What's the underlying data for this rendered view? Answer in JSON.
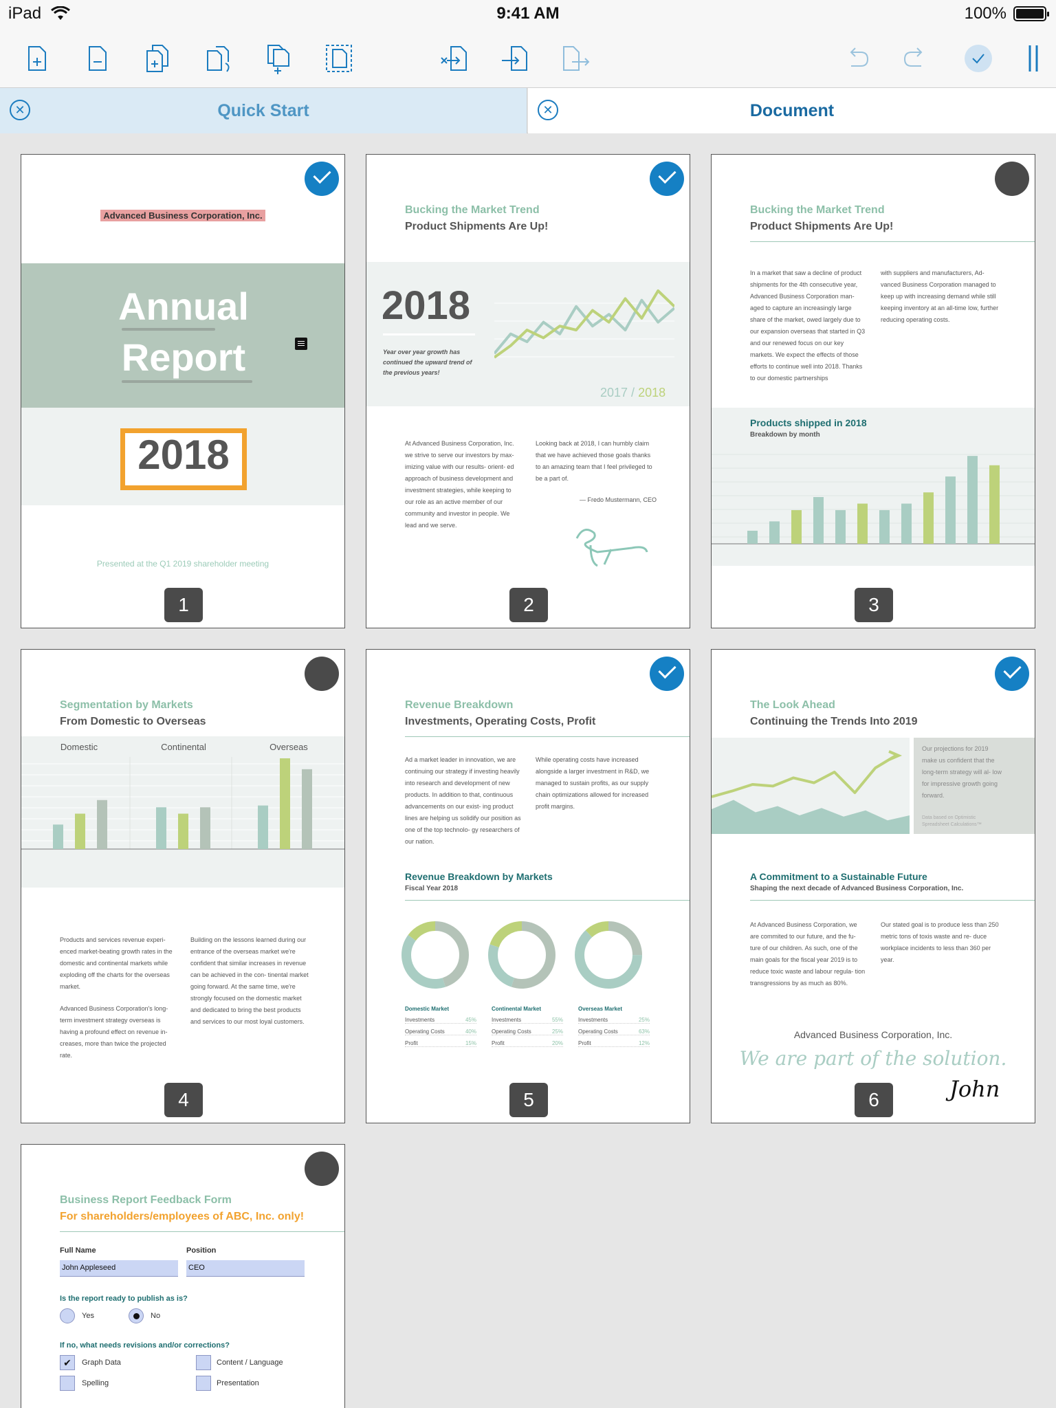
{
  "status": {
    "device": "iPad",
    "time": "9:41 AM",
    "battery": "100%"
  },
  "toolbar": {
    "left_icons": [
      "add-page-icon",
      "remove-page-icon",
      "duplicate-page-icon",
      "rotate-page-icon",
      "insert-pages-icon",
      "select-area-icon"
    ],
    "middle_icons": [
      "extract-page-icon",
      "import-page-icon",
      "export-page-icon"
    ],
    "right_icons": [
      "undo-icon",
      "redo-icon",
      "done-icon",
      "split-view-icon"
    ]
  },
  "tabs": [
    {
      "label": "Quick Start"
    },
    {
      "label": "Document"
    }
  ],
  "pages": [
    {
      "number": "1",
      "selected": true,
      "company": "Advanced Business Corporation, Inc.",
      "title1": "Annual",
      "title2": "Report",
      "year": "2018",
      "footer": "Presented at the Q1 2019 shareholder meeting"
    },
    {
      "number": "2",
      "selected": true,
      "heading": "Bucking the Market Trend",
      "subheading": "Product Shipments Are Up!",
      "year": "2018",
      "caption": "Year over year growth has continued the upward trend of the previous years!",
      "years_a": "2017",
      "years_sep": " / ",
      "years_b": "2018",
      "col1": "At Advanced Business Corporation, Inc. we strive to serve our investors by max- imizing value with our results- orient- ed approach of business development and investment strategies, while keeping to our role as an active member of our community and investor in people. We lead and we serve.",
      "col2": "Looking back at 2018, I can humbly claim that we have achieved those goals thanks to an amazing team that I feel privileged to be a part of.",
      "signoff": "— Fredo Mustermann, CEO"
    },
    {
      "number": "3",
      "selected": false,
      "heading": "Bucking the Market Trend",
      "subheading": "Product Shipments Are Up!",
      "col1": "In a market that saw a decline of product shipments for the 4th consecutive year, Advanced Business Corporation man- aged to capture an increasingly large share of the market, owed largely due to our expansion overseas that started in Q3 and our renewed focus on our key markets. We expect the effects of those efforts to continue well into 2018. Thanks to our domestic partnerships",
      "col2": "with suppliers and manufacturers, Ad- vanced Business Corporation managed to keep up with increasing demand while still keeping inventory at an all-time low, further reducing operating costs.",
      "chart_title": "Products shipped in 2018",
      "chart_sub": "Breakdown by month"
    },
    {
      "number": "4",
      "selected": false,
      "heading": "Segmentation by Markets",
      "subheading": "From Domestic to Overseas",
      "markets": [
        "Domestic",
        "Continental",
        "Overseas"
      ],
      "col1a": "Products and services revenue experi- enced market-beating growth rates in the domestic and continental markets while exploding off the charts for the overseas market.",
      "col1b": "Advanced Business Corporation's long- term investment strategy overseas is having a profound effect on revenue in- creases, more than twice the projected rate.",
      "col2": "Building on the lessons learned during our entrance of the overseas market we're confident that similar increases in revenue can be achieved in the con- tinental market going forward. At the same time, we're strongly focused on the domestic market and dedicated to bring the best products and services to our most loyal customers."
    },
    {
      "number": "5",
      "selected": true,
      "heading": "Revenue Breakdown",
      "subheading": "Investments, Operating Costs, Profit",
      "col1": "Ad a market leader in innovation, we are continuing our strategy if investing heavily into research and development of new products. In addition to that, continuous advancements on our exist- ing product lines are helping us solidify our position as one of the top technolo- gy researchers of our nation.",
      "col2": "While operating costs have increased alongside a larger investment in R&D, we managed to sustain profits, as our supply chain optimizations allowed for increased profit margins.",
      "chart_title": "Revenue Breakdown by Markets",
      "chart_sub": "Fiscal Year 2018",
      "legend": [
        {
          "market": "Domestic Market",
          "rows": [
            [
              "Investments",
              "45%"
            ],
            [
              "Operating Costs",
              "40%"
            ],
            [
              "Profit",
              "15%"
            ]
          ]
        },
        {
          "market": "Continental Market",
          "rows": [
            [
              "Investments",
              "55%"
            ],
            [
              "Operating Costs",
              "25%"
            ],
            [
              "Profit",
              "20%"
            ]
          ]
        },
        {
          "market": "Overseas Market",
          "rows": [
            [
              "Investments",
              "25%"
            ],
            [
              "Operating Costs",
              "63%"
            ],
            [
              "Profit",
              "12%"
            ]
          ]
        }
      ]
    },
    {
      "number": "6",
      "selected": true,
      "heading": "The Look Ahead",
      "subheading": "Continuing the Trends Into 2019",
      "projection": "Our projections for 2019 make us confident that the long-term strategy will al- low for impressive growth going forward.",
      "projection_note": "Data based on Optimistic Spreadsheet Calculations™",
      "heading2": "A Commitment to a Sustainable Future",
      "sub2": "Shaping the next decade of Advanced Business Corporation, Inc.",
      "col1": "At Advanced Business Corporation, we are commited to our future, and the fu- ture of our children. As such, one of the main goals for the fiscal year 2019 is to reduce toxic waste and labour regula- tion transgressions by as much as 80%.",
      "col2": "Our stated goal is to produce less than 250 metric tons of toxis waste and re- duce workplace incidents to less than 360 per year.",
      "company": "Advanced Business Corporation, Inc.",
      "slogan": "We are part of the solution.",
      "signature": "John"
    },
    {
      "number": "7",
      "selected": false,
      "heading": "Business Report Feedback Form",
      "subheading": "For shareholders/employees of ABC, Inc. only!",
      "full_name_label": "Full Name",
      "full_name_value": "John Appleseed",
      "position_label": "Position",
      "position_value": "CEO",
      "q1": "Is the report ready to publish as is?",
      "yes": "Yes",
      "no": "No",
      "q2": "If no, what needs revisions and/or corrections?",
      "options": [
        {
          "label": "Graph Data",
          "checked": true
        },
        {
          "label": "Content / Language",
          "checked": false
        },
        {
          "label": "Spelling",
          "checked": false
        },
        {
          "label": "Presentation",
          "checked": false
        }
      ]
    }
  ],
  "chart_data": [
    {
      "type": "line",
      "series": [
        {
          "values": [
            20,
            45,
            35,
            60,
            45,
            80,
            55,
            70,
            50,
            88,
            60,
            78
          ]
        },
        {
          "values": [
            15,
            30,
            50,
            40,
            55,
            50,
            75,
            60,
            90,
            65,
            100,
            80
          ]
        }
      ],
      "colors": [
        "#a9cdc3",
        "#bdd27a"
      ]
    },
    {
      "type": "bar",
      "title": "Products shipped in 2018",
      "subtitle": "Breakdown by month",
      "values": [
        14,
        24,
        36,
        50,
        36,
        43,
        36,
        43,
        55,
        72,
        94,
        84
      ],
      "colors": [
        "#a9cdc3",
        "#a9cdc3",
        "#bdd27a",
        "#a9cdc3",
        "#a9cdc3",
        "#bdd27a",
        "#a9cdc3",
        "#a9cdc3",
        "#bdd27a",
        "#a9cdc3",
        "#a9cdc3",
        "#bdd27a"
      ]
    },
    {
      "type": "bar",
      "categories": [
        "Domestic",
        "Continental",
        "Overseas"
      ],
      "series": [
        {
          "values": [
            27,
            46,
            48
          ]
        },
        {
          "values": [
            39,
            39,
            100
          ]
        },
        {
          "values": [
            54,
            46,
            88
          ]
        }
      ],
      "colors": [
        "#a9cdc3",
        "#bdd27a",
        "#b4c3b8"
      ]
    },
    {
      "type": "pie",
      "title": "Revenue Breakdown by Markets",
      "subtitle": "Fiscal Year 2018",
      "charts": [
        {
          "market": "Domestic Market",
          "slices": [
            {
              "label": "Investments",
              "value": 45
            },
            {
              "label": "Operating Costs",
              "value": 40
            },
            {
              "label": "Profit",
              "value": 15
            }
          ]
        },
        {
          "market": "Continental Market",
          "slices": [
            {
              "label": "Investments",
              "value": 55
            },
            {
              "label": "Operating Costs",
              "value": 25
            },
            {
              "label": "Profit",
              "value": 20
            }
          ]
        },
        {
          "market": "Overseas Market",
          "slices": [
            {
              "label": "Investments",
              "value": 25
            },
            {
              "label": "Operating Costs",
              "value": 63
            },
            {
              "label": "Profit",
              "value": 12
            }
          ]
        }
      ],
      "colors": [
        "#b4c3b8",
        "#a9cdc3",
        "#bdd27a"
      ]
    },
    {
      "type": "area",
      "series": [
        {
          "values": [
            40,
            55,
            35,
            45,
            30,
            42,
            28,
            38,
            22,
            30
          ]
        },
        {
          "values": [
            45,
            52,
            60,
            58,
            68,
            62,
            75,
            50,
            80,
            95
          ]
        }
      ],
      "colors": [
        "#a9cdc3",
        "#bdd27a"
      ]
    }
  ]
}
